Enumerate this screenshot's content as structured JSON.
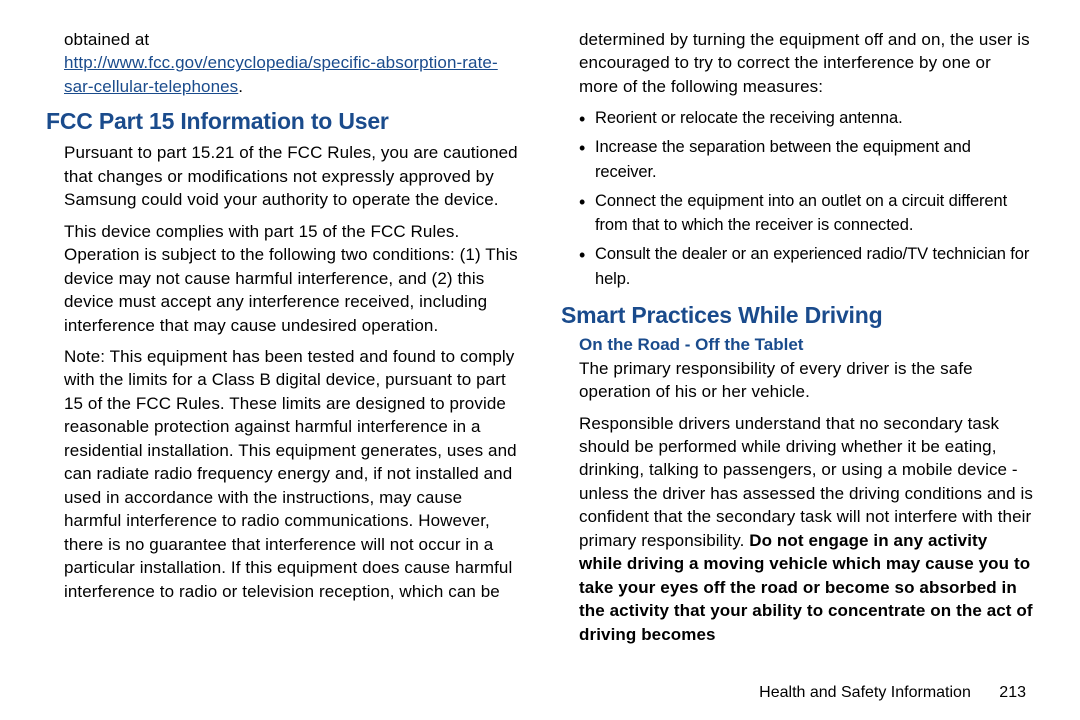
{
  "left": {
    "obtained_prefix": "obtained at",
    "link_text": "http://www.fcc.gov/encyclopedia/specific-absorption-rate-sar-cellular-telephones",
    "link_suffix": ".",
    "heading_fcc": "FCC Part 15 Information to User",
    "p1": "Pursuant to part 15.21 of the FCC Rules, you are cautioned that changes or modifications not expressly approved by Samsung could void your authority to operate the device.",
    "p2": "This device complies with part 15 of the FCC Rules. Operation is subject to the following two conditions: (1) This device may not cause harmful interference, and (2) this device must accept any interference received, including interference that may cause undesired operation.",
    "p3": "Note: This equipment has been tested and found to comply with the limits for a Class B digital device, pursuant to part 15 of the FCC Rules. These limits are designed to provide reasonable protection against harmful interference in a residential installation. This equipment generates, uses and can radiate radio frequency energy and, if not installed and used in accordance with the instructions, may cause harmful interference to radio communications. However, there is no guarantee that interference will not occur in a particular installation. If this equipment does cause harmful interference to radio or television reception, which can be"
  },
  "right": {
    "p_cont": "determined by turning the equipment off and on, the user is encouraged to try to correct the interference by one or more of the following measures:",
    "bullets": [
      "Reorient or relocate the receiving antenna.",
      "Increase the separation between the equipment and receiver.",
      "Connect the equipment into an outlet on a circuit different from that to which the receiver is connected.",
      "Consult the dealer or an experienced radio/TV technician for help."
    ],
    "heading_smart": "Smart Practices While Driving",
    "subheading": "On the Road - Off the Tablet",
    "p1": "The primary responsibility of every driver is the safe operation of his or her vehicle.",
    "p2_start": "Responsible drivers understand that no secondary task should be performed while driving whether it be eating, drinking, talking to passengers, or using a mobile device - unless the driver has assessed the driving conditions and is confident that the secondary task will not interfere with their primary responsibility. ",
    "p2_bold": "Do not engage in any activity while driving a moving vehicle which may cause you to take your eyes off the road or become so absorbed in the activity that your ability to concentrate on the act of driving becomes"
  },
  "footer": {
    "section": "Health and Safety Information",
    "page": "213"
  }
}
